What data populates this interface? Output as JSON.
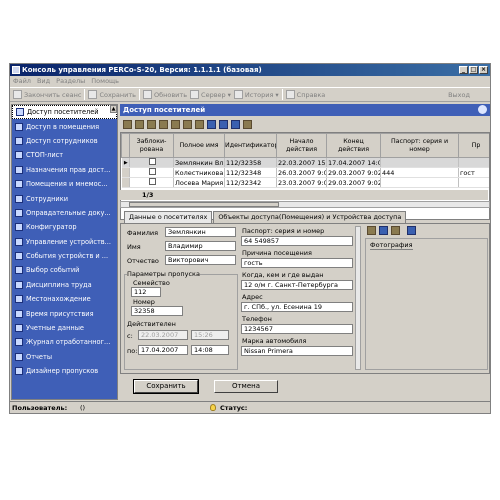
{
  "window": {
    "title": "Консоль управления PERCo-S-20, Версия: 1.1.1.1 (базовая)"
  },
  "menu": [
    "Файл",
    "Вид",
    "Разделы",
    "Помощь"
  ],
  "toolbar": {
    "items": [
      "Закончить сеанс",
      "Сохранить",
      "Обновить",
      "Сервер",
      "История",
      "Справка"
    ],
    "exit": "Выход"
  },
  "sidebar": {
    "items": [
      "Доступ посетителей",
      "Доступ в помещения",
      "Доступ сотрудников",
      "СТОП-лист",
      "Назначения прав дост...",
      "Помещения и мнемос...",
      "Сотрудники",
      "Оправдательные доку...",
      "Конфигуратор",
      "Управление устройств...",
      "События устройств и ...",
      "Выбор событий",
      "Дисциплина труда",
      "Местонахождение",
      "Время присутствия",
      "Учетные данные",
      "Журнал отработанног...",
      "Отчеты",
      "Дизайнер пропусков"
    ]
  },
  "panel": {
    "title": "Доступ посетителей"
  },
  "grid": {
    "columns": [
      "Заблоки-рована",
      "Полное имя",
      "Идентификатор",
      "Начало действия",
      "Конец действия",
      "Паспорт: серия и номер",
      "Пр"
    ],
    "rows": [
      {
        "name": "Землянкин Вл",
        "id": "112/32358",
        "start": "22.03.2007 15:26",
        "end": "17.04.2007 14:08",
        "passport": "",
        "pr": ""
      },
      {
        "name": "Колестникова Г",
        "id": "112/32348",
        "start": "26.03.2007 9:02:0",
        "end": "29.03.2007 9:02:0",
        "passport": "444",
        "pr": "гост"
      },
      {
        "name": "Лосева Мария Г",
        "id": "112/32342",
        "start": "23.03.2007 9:02:0",
        "end": "29.03.2007 9:02:0",
        "passport": "",
        "pr": ""
      }
    ],
    "count": "1/3"
  },
  "tabs": [
    "Данные о посетителях",
    "Объекты доступа(Помещения) и Устройства доступа"
  ],
  "form": {
    "surname_label": "Фамилия",
    "surname": "Землянкин",
    "name_label": "Имя",
    "name": "Владимир",
    "patronymic_label": "Отчество",
    "patronymic": "Викторович",
    "pass_params_label": "Параметры пропуска",
    "family_label": "Семейство",
    "family": "112",
    "number_label": "Номер",
    "number": "32358",
    "valid_label": "Действителен",
    "from_label": "с:",
    "from_date": "22.03.2007",
    "from_time": "15:26",
    "to_label": "по:",
    "to_date": "17.04.2007",
    "to_time": "14:08",
    "passport_label": "Паспорт: серия и номер",
    "passport": "64 549857",
    "reason_label": "Причина посещения",
    "reason": "гость",
    "issued_label": "Когда, кем и где выдан",
    "issued": "12 о/м г. Санкт-Петербурга",
    "address_label": "Адрес",
    "address": "г. СПб., ул. Есенина 19",
    "phone_label": "Телефон",
    "phone": "1234567",
    "car_label": "Марка автомобиля",
    "car": "Nissan Primera",
    "photo_label": "Фотография"
  },
  "buttons": {
    "save": "Сохранить",
    "cancel": "Отмена"
  },
  "status": {
    "user_label": "Пользователь:",
    "user_value": "()",
    "status_label": "Статус:"
  },
  "colors": {
    "sidebar_bg": "#3f5fb7",
    "titlebar": "#0a246a",
    "panel_title": "#3f5fb7"
  }
}
